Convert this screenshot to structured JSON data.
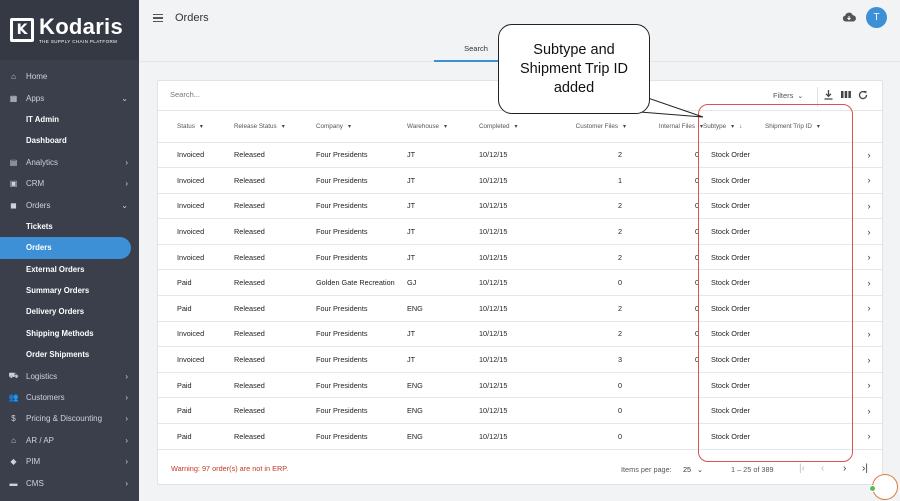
{
  "brand": {
    "name": "Kodaris",
    "tagline": "THE SUPPLY CHAIN PLATFORM",
    "mark": "K"
  },
  "sidebar": {
    "items": [
      {
        "label": "Home",
        "icon": "home-icon",
        "glyph": "⌂",
        "type": "top",
        "chevron": ""
      },
      {
        "label": "Apps",
        "icon": "grid-icon",
        "glyph": "▦",
        "type": "top",
        "chevron": "⌄"
      },
      {
        "label": "IT Admin",
        "type": "sub"
      },
      {
        "label": "Dashboard",
        "type": "sub"
      },
      {
        "label": "Analytics",
        "icon": "analytics-icon",
        "glyph": "▤",
        "type": "top",
        "chevron": "›"
      },
      {
        "label": "CRM",
        "icon": "crm-icon",
        "glyph": "▣",
        "type": "top",
        "chevron": "›"
      },
      {
        "label": "Orders",
        "icon": "orders-icon",
        "glyph": "◼",
        "type": "top",
        "chevron": "⌄"
      },
      {
        "label": "Tickets",
        "type": "sub"
      },
      {
        "label": "Orders",
        "type": "sub",
        "active": true
      },
      {
        "label": "External Orders",
        "type": "sub"
      },
      {
        "label": "Summary Orders",
        "type": "sub"
      },
      {
        "label": "Delivery Orders",
        "type": "sub"
      },
      {
        "label": "Shipping Methods",
        "type": "sub"
      },
      {
        "label": "Order Shipments",
        "type": "sub"
      },
      {
        "label": "Logistics",
        "icon": "truck-icon",
        "glyph": "⛟",
        "type": "top",
        "chevron": "›"
      },
      {
        "label": "Customers",
        "icon": "customers-icon",
        "glyph": "👥",
        "type": "top",
        "chevron": "›"
      },
      {
        "label": "Pricing & Discounting",
        "icon": "dollar-icon",
        "glyph": "$",
        "type": "top",
        "chevron": "›"
      },
      {
        "label": "AR / AP",
        "icon": "bank-icon",
        "glyph": "⌂",
        "type": "top",
        "chevron": "›"
      },
      {
        "label": "PIM",
        "icon": "tag-icon",
        "glyph": "◆",
        "type": "top",
        "chevron": "›"
      },
      {
        "label": "CMS",
        "icon": "cms-icon",
        "glyph": "▬",
        "type": "top",
        "chevron": "›"
      }
    ]
  },
  "header": {
    "title": "Orders",
    "avatar_initial": "T"
  },
  "tabs": {
    "search": "Search"
  },
  "toolbar": {
    "search_placeholder": "Search...",
    "filters_label": "Filters"
  },
  "table": {
    "columns": [
      "Status",
      "Release Status",
      "Company",
      "Warehouse",
      "Completed",
      "Customer Files",
      "Internal Files",
      "Subtype",
      "Shipment Trip ID"
    ],
    "rows": [
      [
        "Invoiced",
        "Released",
        "Four Presidents",
        "JT",
        "10/12/15",
        "2",
        "0",
        "Stock Order",
        ""
      ],
      [
        "Invoiced",
        "Released",
        "Four Presidents",
        "JT",
        "10/12/15",
        "1",
        "0",
        "Stock Order",
        ""
      ],
      [
        "Invoiced",
        "Released",
        "Four Presidents",
        "JT",
        "10/12/15",
        "2",
        "0",
        "Stock Order",
        ""
      ],
      [
        "Invoiced",
        "Released",
        "Four Presidents",
        "JT",
        "10/12/15",
        "2",
        "0",
        "Stock Order",
        ""
      ],
      [
        "Invoiced",
        "Released",
        "Four Presidents",
        "JT",
        "10/12/15",
        "2",
        "0",
        "Stock Order",
        ""
      ],
      [
        "Paid",
        "Released",
        "Golden Gate Recreation",
        "GJ",
        "10/12/15",
        "0",
        "0",
        "Stock Order",
        ""
      ],
      [
        "Paid",
        "Released",
        "Four Presidents",
        "ENG",
        "10/12/15",
        "2",
        "0",
        "Stock Order",
        ""
      ],
      [
        "Invoiced",
        "Released",
        "Four Presidents",
        "JT",
        "10/12/15",
        "2",
        "0",
        "Stock Order",
        ""
      ],
      [
        "Invoiced",
        "Released",
        "Four Presidents",
        "JT",
        "10/12/15",
        "3",
        "0",
        "Stock Order",
        ""
      ],
      [
        "Paid",
        "Released",
        "Four Presidents",
        "ENG",
        "10/12/15",
        "0",
        "",
        "Stock Order",
        ""
      ],
      [
        "Paid",
        "Released",
        "Four Presidents",
        "ENG",
        "10/12/15",
        "0",
        "",
        "Stock Order",
        ""
      ],
      [
        "Paid",
        "Released",
        "Four Presidents",
        "ENG",
        "10/12/15",
        "0",
        "",
        "Stock Order",
        ""
      ]
    ]
  },
  "footer": {
    "warning": "Warning: 97 order(s) are not in ERP.",
    "items_per_page_label": "Items per page:",
    "items_per_page_value": "25",
    "range": "1 – 25 of 389"
  },
  "annotation": {
    "line1": "Subtype and",
    "line2": "Shipment Trip ID",
    "line3": "added"
  },
  "colors": {
    "sidebar_bg": "#3a3f4b",
    "accent": "#3d8fd6",
    "warning": "#c0392b",
    "highlight": "#d9534f"
  }
}
